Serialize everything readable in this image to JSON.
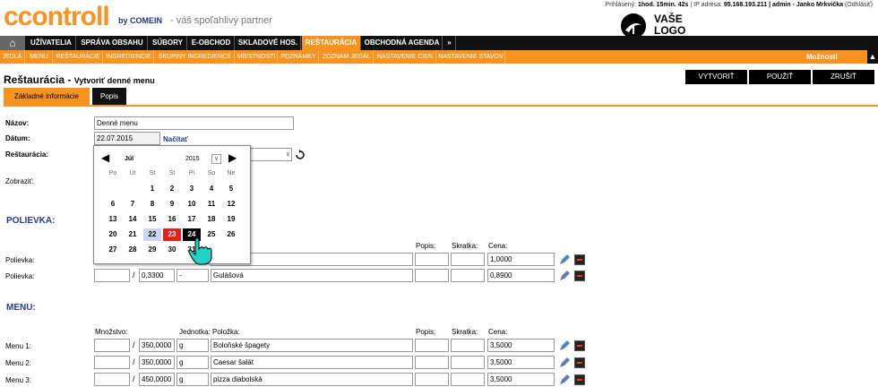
{
  "header": {
    "logo": "ccontroll",
    "logo_by": "by COMEIN",
    "tagline": "- váš spoľahlivý partner",
    "vase_logo_line1": "VAŠE",
    "vase_logo_line2": "LOGO",
    "status_prefix": "Prihlásený:",
    "status_time": "1hod. 15min. 42s",
    "status_ip_label": "| IP adresa:",
    "status_ip": "95.168.193.211",
    "status_user": "| admin - Janko Mrkvička",
    "status_logout": "(Odhlásiť)"
  },
  "nav1": {
    "items": [
      "UŽÍVATELIA",
      "SPRÁVA OBSAHU",
      "SÚBORY",
      "E-OBCHOD",
      "SKLADOVÉ HOS.",
      "REŠTAURÁCIA",
      "OBCHODNÁ AGENDA",
      "»"
    ]
  },
  "nav2": {
    "items": [
      "JEDLÁ",
      "MENU",
      "REŠTAURÁCIE",
      "INGREDIENCIE",
      "SKUPINY INGREDIENCIÍ",
      "MIESTNOSTI",
      "POZNÁMKY",
      "ZOZNAM JEDÁL",
      "NASTAVENIE CIEN",
      "NASTAVENIE STAVOV"
    ],
    "options": "Možnosti"
  },
  "page": {
    "title": "Reštaurácia -",
    "subtitle": "Vytvoriť denné menu",
    "btn_create": "VYTVORIŤ",
    "btn_use": "POUŽIŤ",
    "btn_cancel": "ZRUŠIŤ",
    "tab_basic": "Základné informácie",
    "tab_desc": "Popis"
  },
  "form": {
    "name_label": "Názov:",
    "name_value": "Denné menu",
    "date_label": "Dátum:",
    "date_value": "22.07.2015",
    "load_link": "Načítať",
    "restaurant_label": "Reštaurácia:",
    "show_label": "Zobraziť:"
  },
  "calendar": {
    "month": "Júl",
    "year": "2015",
    "dow": [
      "Po",
      "Ut",
      "St",
      "Št",
      "Pi",
      "So",
      "Ne"
    ],
    "weeks": [
      [
        "",
        "",
        "1",
        "2",
        "3",
        "4",
        "5"
      ],
      [
        "6",
        "7",
        "8",
        "9",
        "10",
        "11",
        "12"
      ],
      [
        "13",
        "14",
        "15",
        "16",
        "17",
        "18",
        "19"
      ],
      [
        "20",
        "21",
        "22",
        "23",
        "24",
        "25",
        "26"
      ],
      [
        "27",
        "28",
        "29",
        "30",
        "31",
        "",
        ""
      ]
    ]
  },
  "soups": {
    "section": "POLIEVKA:",
    "col_desc": "Popis:",
    "col_short": "Skratka:",
    "col_price": "Cena:",
    "rows": [
      {
        "label": "Polievka:",
        "qty": "",
        "amount": "",
        "unit": "",
        "item": "",
        "price": "1,0000"
      },
      {
        "label": "Polievka:",
        "qty": "",
        "amount": "0,3300",
        "unit": "-",
        "item": "Gulášová",
        "price": "0,8900"
      }
    ]
  },
  "menu": {
    "section": "MENU:",
    "col_qty": "Množstvo:",
    "col_unit": "Jednotka:",
    "col_item": "Položka:",
    "col_desc": "Popis:",
    "col_short": "Skratka:",
    "col_price": "Cena:",
    "rows": [
      {
        "label": "Menu 1:",
        "amount": "350,0000",
        "unit": "g",
        "item": "Boloňské špagety",
        "price": "3,5000"
      },
      {
        "label": "Menu 2:",
        "amount": "350,0000",
        "unit": "g",
        "item": "Caesar šalát",
        "price": "3,5000"
      },
      {
        "label": "Menu 3:",
        "amount": "450,0000",
        "unit": "g",
        "item": "pizza diabolská",
        "price": "3,5000"
      }
    ]
  }
}
